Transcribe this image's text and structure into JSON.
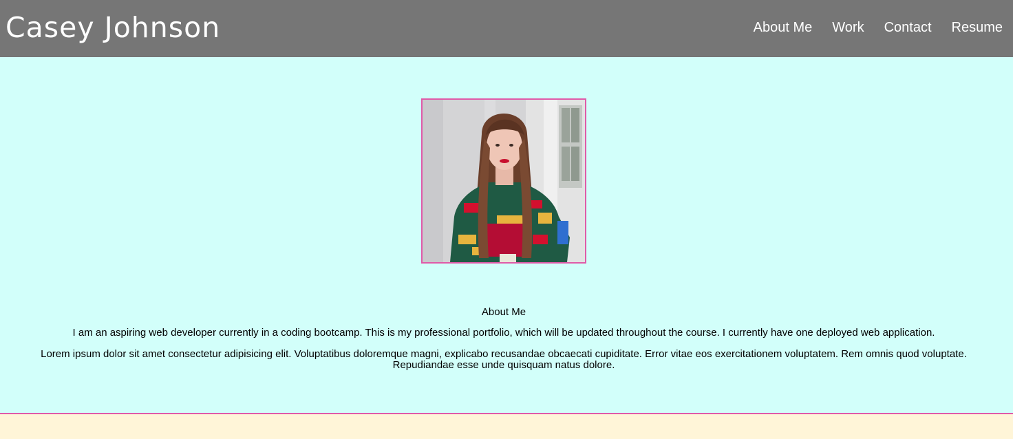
{
  "header": {
    "site_title": "Casey Johnson",
    "nav": [
      "About Me",
      "Work",
      "Contact",
      "Resume"
    ]
  },
  "about": {
    "photo_alt": "Portrait of Casey Johnson",
    "heading": "About Me",
    "paragraphs": [
      "I am an aspiring web developer currently in a coding bootcamp. This is my professional portfolio, which will be updated throughout the course. I currently have one deployed web application.",
      "Lorem ipsum dolor sit amet consectetur adipisicing elit. Voluptatibus doloremque magni, explicabo recusandae obcaecati cupiditate. Error vitae eos exercitationem voluptatem. Rem omnis quod voluptate. Repudiandae esse unde quisquam natus dolore."
    ]
  },
  "colors": {
    "header_bg": "#767676",
    "main_bg": "#d2fffa",
    "accent_border": "#e05aa8",
    "footer_bg": "#fff5d8"
  }
}
